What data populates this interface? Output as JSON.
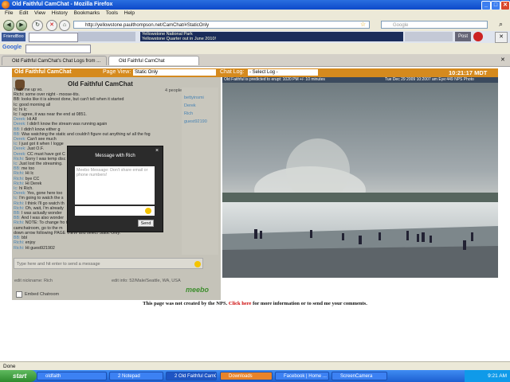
{
  "window": {
    "title": "Old Faithful CamChat - Mozilla Firefox"
  },
  "menu": [
    "File",
    "Edit",
    "View",
    "History",
    "Bookmarks",
    "Tools",
    "Help"
  ],
  "nav": {
    "url": "http://yellowstone.paulthompson.net/CamChat/#StaticOnly",
    "search_placeholder": "Google"
  },
  "friendbar": {
    "label": "FriendBoo",
    "post": "Post",
    "ticker_line1": "Yellowstone National Park",
    "ticker_line2": "Yellowstone Quarter out in June 2010!",
    "ticker_url": "http://www.facebook.com/l.php?u=http%253A%252F%252Fnews.coinupdate.com%252F..."
  },
  "googlebar": {
    "label": "Google"
  },
  "tabs": [
    {
      "label": "Old Faithful CamChat's Chat Logs from ..."
    },
    {
      "label": "Old Faithful CamChat"
    }
  ],
  "header": {
    "brand": "Old Faithful CamChat",
    "page_view_label": "Page View:",
    "page_view_value": "Static Only",
    "chat_log_label": "Chat Log:",
    "chat_log_value": "- Select Log -",
    "clock": "10:21:17 MDT"
  },
  "chatroom": {
    "title": "Old Faithful CamChat",
    "people": "4 people in this room",
    "input_placeholder": "Type here and hit enter to send a message",
    "edit_nickname": "edit nickname: Rich",
    "edit_info": "edit info: 52/Male/Seattle, WA, USA",
    "embed": "Embed Chatroom",
    "logo": "meebo"
  },
  "users": [
    "bettyinsmi",
    "Derek",
    "Rich",
    "guest92190"
  ],
  "messages": [
    {
      "who": "",
      "text": "Yeah me up vo."
    },
    {
      "who": "",
      "text": "Richi: some over night - moose-tits."
    },
    {
      "who": "",
      "text": "BB: looks like it is almost done, but can't tell when it started"
    },
    {
      "who": "",
      "text": "Ic: good morning all"
    },
    {
      "who": "",
      "text": "Ic: hi Ic"
    },
    {
      "who": "",
      "text": "Ic: I agree, it was near the end at 0851."
    },
    {
      "who": "Derek:",
      "text": "Hi All"
    },
    {
      "who": "Derek:",
      "text": "I didn't know the stream was running again"
    },
    {
      "who": "BB:",
      "text": "I didn't know either g"
    },
    {
      "who": "BB:",
      "text": "Was watching the static and couldn't figure out anything w/ all the fog"
    },
    {
      "who": "Derek:",
      "text": "Can't see much"
    },
    {
      "who": "Ic:",
      "text": "I just got it when I logge"
    },
    {
      "who": "Derek:",
      "text": "Just O.F."
    },
    {
      "who": "Derek:",
      "text": "CC must have got C"
    },
    {
      "who": "Richi:",
      "text": "Sorry I was temp disc"
    },
    {
      "who": "Ic:",
      "text": "Just lost the streaming."
    },
    {
      "who": "BB:",
      "text": "me too"
    },
    {
      "who": "Richi:",
      "text": "Hi Ic"
    },
    {
      "who": "Richi:",
      "text": "bye CC"
    },
    {
      "who": "Richi:",
      "text": "Hi Derek"
    },
    {
      "who": "Ic:",
      "text": "hi Rich."
    },
    {
      "who": "Derek:",
      "text": "Yes, gone here too"
    },
    {
      "who": "Ic:",
      "text": "I'm going to watch the s"
    },
    {
      "who": "Richi:",
      "text": "I think I'll go watch th"
    },
    {
      "who": "Richi:",
      "text": "Oh, wait, I'm already"
    },
    {
      "who": "BB:",
      "text": "I was actually wonder"
    },
    {
      "who": "BB:",
      "text": "And I was also wonder"
    },
    {
      "who": "Richi:",
      "text": "NOTE: To change fro                                   the drop"
    },
    {
      "who": "",
      "text": "camchatroom, go to the m"
    },
    {
      "who": "",
      "text": "down arrow following PAGE VIEW and select Static Only."
    },
    {
      "who": "BB:",
      "text": "bbl"
    },
    {
      "who": "Richi:",
      "text": "enjoy"
    },
    {
      "who": "Richi:",
      "text": "Hi guest921902"
    }
  ],
  "dialog": {
    "title": "Message with Rich",
    "placeholder": "Meebo Message: Don't share email or phone numbers!",
    "send": "Send"
  },
  "camera": {
    "caption_left": "Old Faithful is predicted to erupt: 1020 PM +/- 10 minutes",
    "caption_right": "Tue Dec 29 2009   10:2007 am Eye:449 NPS Photo"
  },
  "footer": {
    "text_before": "This page was not created by the NPS.",
    "link": "Click here",
    "text_after": "for more information or to send me your comments."
  },
  "status": {
    "text": "Done"
  },
  "taskbar": {
    "start": "start",
    "items": [
      "oldfaith",
      "2 Notepad",
      "2 Old Faithful CamC...",
      "Downloads",
      "Facebook | Home ...",
      "ScreenCamera"
    ],
    "time": "9:21 AM"
  }
}
